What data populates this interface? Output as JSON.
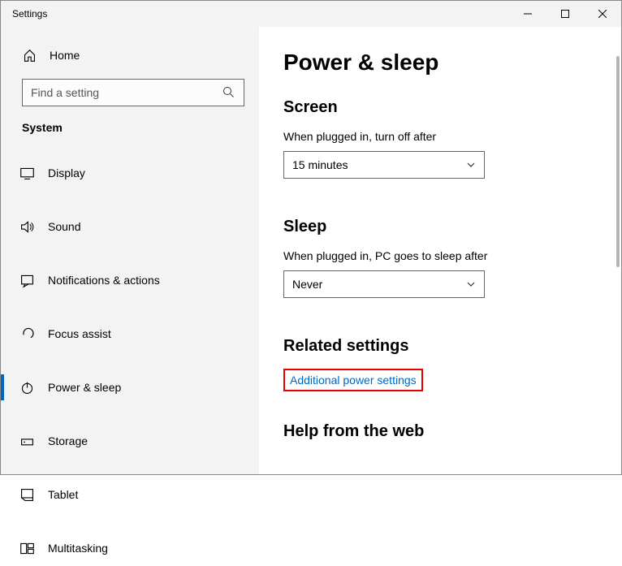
{
  "window": {
    "title": "Settings"
  },
  "sidebar": {
    "home": "Home",
    "search_placeholder": "Find a setting",
    "section": "System",
    "items": [
      {
        "label": "Display"
      },
      {
        "label": "Sound"
      },
      {
        "label": "Notifications & actions"
      },
      {
        "label": "Focus assist"
      },
      {
        "label": "Power & sleep"
      },
      {
        "label": "Storage"
      },
      {
        "label": "Tablet"
      },
      {
        "label": "Multitasking"
      }
    ]
  },
  "main": {
    "title": "Power & sleep",
    "screen": {
      "heading": "Screen",
      "label": "When plugged in, turn off after",
      "value": "15 minutes"
    },
    "sleep": {
      "heading": "Sleep",
      "label": "When plugged in, PC goes to sleep after",
      "value": "Never"
    },
    "related": {
      "heading": "Related settings",
      "link": "Additional power settings"
    },
    "help": {
      "heading": "Help from the web"
    }
  }
}
